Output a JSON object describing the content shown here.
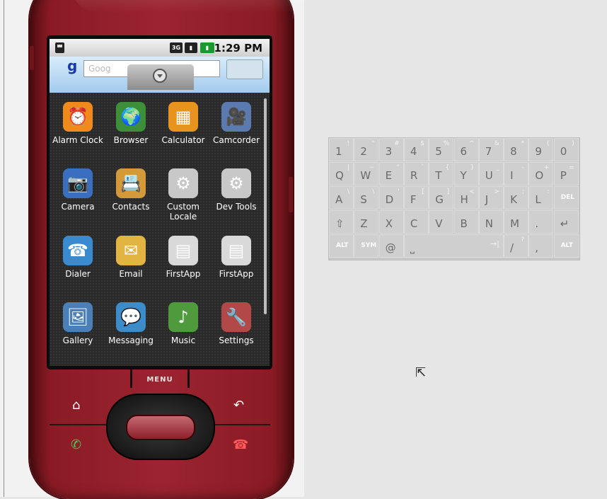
{
  "status_bar": {
    "time": "1:29 PM",
    "network": "3G"
  },
  "search_widget": {
    "logo": "g",
    "placeholder": "Goog"
  },
  "apps": [
    {
      "label": "Alarm Clock",
      "icon": "alarm-clock-icon",
      "glyph": "⏰",
      "color": "#f08a1c"
    },
    {
      "label": "Browser",
      "icon": "globe-icon",
      "glyph": "🌍",
      "color": "#3d8f3a"
    },
    {
      "label": "Calculator",
      "icon": "calculator-icon",
      "glyph": "▦",
      "color": "#e6941e"
    },
    {
      "label": "Camcorder",
      "icon": "camcorder-icon",
      "glyph": "🎥",
      "color": "#5a7ab0"
    },
    {
      "label": "Camera",
      "icon": "camera-icon",
      "glyph": "📷",
      "color": "#3a6fbf"
    },
    {
      "label": "Contacts",
      "icon": "contacts-icon",
      "glyph": "📇",
      "color": "#d49a3a"
    },
    {
      "label": "Custom\nLocale",
      "icon": "gear-icon",
      "glyph": "⚙",
      "color": "#c8c8c8"
    },
    {
      "label": "Dev Tools",
      "icon": "gear-icon",
      "glyph": "⚙",
      "color": "#c8c8c8"
    },
    {
      "label": "Dialer",
      "icon": "dialer-icon",
      "glyph": "☎",
      "color": "#3a8ad0"
    },
    {
      "label": "Email",
      "icon": "email-icon",
      "glyph": "✉",
      "color": "#e2b441"
    },
    {
      "label": "FirstApp",
      "icon": "document-icon",
      "glyph": "▤",
      "color": "#d9d9d9"
    },
    {
      "label": "FirstApp",
      "icon": "document-icon",
      "glyph": "▤",
      "color": "#d9d9d9"
    },
    {
      "label": "Gallery",
      "icon": "gallery-icon",
      "glyph": "🖼",
      "color": "#4a7fb8"
    },
    {
      "label": "Messaging",
      "icon": "messaging-icon",
      "glyph": "💬",
      "color": "#3c8cc9"
    },
    {
      "label": "Music",
      "icon": "music-icon",
      "glyph": "♪",
      "color": "#4f9a3c"
    },
    {
      "label": "Settings",
      "icon": "settings-icon",
      "glyph": "🔧",
      "color": "#b34848"
    }
  ],
  "hardware": {
    "menu_label": "MENU",
    "home": "⌂",
    "back": "↶",
    "call": "✆",
    "end_call": "☎"
  },
  "keyboard": {
    "rows": [
      [
        [
          "1",
          "!"
        ],
        [
          "2",
          "\""
        ],
        [
          "3",
          "#"
        ],
        [
          "4",
          "$"
        ],
        [
          "5",
          "%"
        ],
        [
          "6",
          "^"
        ],
        [
          "7",
          "&"
        ],
        [
          "8",
          "*"
        ],
        [
          "9",
          "("
        ],
        [
          "0",
          ")"
        ]
      ],
      [
        [
          "Q",
          "|"
        ],
        [
          "W",
          "~"
        ],
        [
          "E",
          "\""
        ],
        [
          "R",
          "`"
        ],
        [
          "T",
          "{"
        ],
        [
          "Y",
          "}"
        ],
        [
          "U",
          "_"
        ],
        [
          "I",
          "-"
        ],
        [
          "O",
          "+"
        ],
        [
          "P",
          "="
        ]
      ],
      [
        [
          "A",
          "\\"
        ],
        [
          "S",
          "\\"
        ],
        [
          "D",
          "'"
        ],
        [
          "F",
          "["
        ],
        [
          "G",
          "]"
        ],
        [
          "H",
          "<"
        ],
        [
          "J",
          ">"
        ],
        [
          "K",
          ";"
        ],
        [
          "L",
          ":"
        ],
        [
          "DEL",
          ""
        ]
      ],
      [
        [
          "⇧",
          ""
        ],
        [
          "Z",
          ""
        ],
        [
          "X",
          ""
        ],
        [
          "C",
          ""
        ],
        [
          "V",
          ""
        ],
        [
          "B",
          ""
        ],
        [
          "N",
          ""
        ],
        [
          "M",
          ""
        ],
        [
          ".",
          ""
        ],
        [
          "↵",
          ""
        ]
      ]
    ],
    "bottom": {
      "alt_left": "ALT",
      "sym": "SYM",
      "at": "@",
      "space": "⎵",
      "tab": "→|",
      "slash": "/",
      "slash_sub": "?",
      "comma": ",",
      "alt_right": "ALT"
    }
  }
}
